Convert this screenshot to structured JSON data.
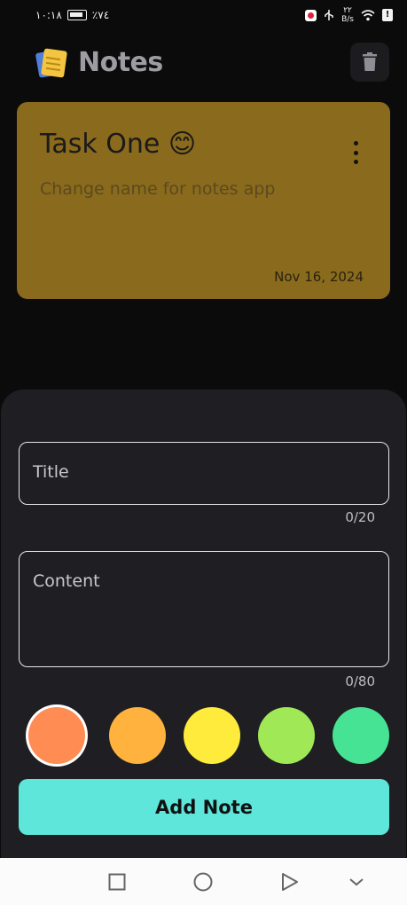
{
  "status_bar": {
    "time": "١٠:١٨",
    "battery": "٪٧٤",
    "speed_value": "٢٢",
    "speed_unit": "B/s"
  },
  "header": {
    "title": "Notes",
    "logo_icon": "notes-logo-icon",
    "delete_icon": "trash-icon"
  },
  "notes": [
    {
      "title": "Task One 😊",
      "content": "Change name for notes app",
      "date": "Nov 16, 2024",
      "color": "#8a6a1c"
    }
  ],
  "form": {
    "title_placeholder": "Title",
    "title_counter": "0/20",
    "content_placeholder": "Content",
    "content_counter": "0/80",
    "colors": [
      "#ff8c52",
      "#ffb23e",
      "#ffeb3b",
      "#a0e856",
      "#47e394"
    ],
    "selected_color": "#ff8c52",
    "submit_label": "Add Note",
    "submit_color": "#5de6d9"
  },
  "nav_bar": {
    "buttons": [
      "recents-square-icon",
      "home-circle-icon",
      "back-triangle-icon",
      "collapse-chevron-icon"
    ]
  }
}
